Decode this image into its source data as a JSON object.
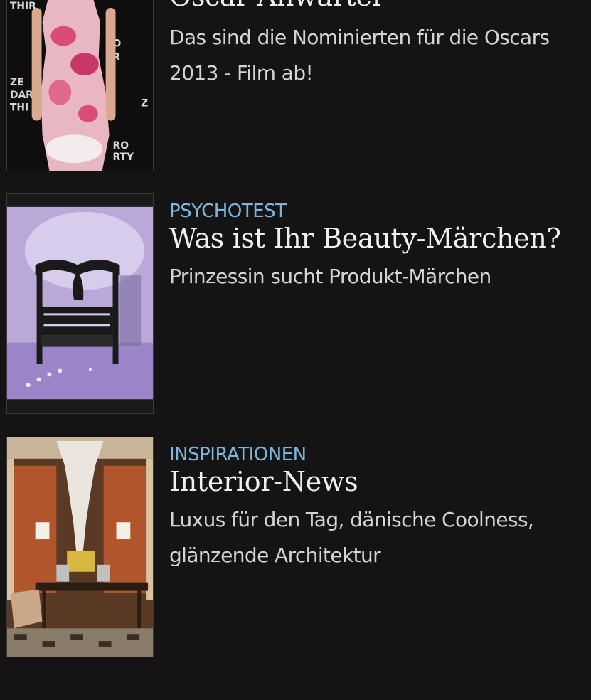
{
  "articles": [
    {
      "kicker": "",
      "headline": "Oscar-Anwärter",
      "teaser_lines": [
        "Das sind die Nominierten für die Oscars",
        "2013 - Film ab!"
      ],
      "thumbnail_icon": "red-carpet-photo"
    },
    {
      "kicker": "PSYCHOTEST",
      "headline": "Was ist Ihr Beauty-Märchen?",
      "teaser_lines": [
        "Prinzessin sucht Produkt-Märchen"
      ],
      "thumbnail_icon": "fairytale-bed-illustration"
    },
    {
      "kicker": "INSPIRATIONEN",
      "headline": "Interior-News",
      "teaser_lines": [
        "Luxus für den Tag, dänische Coolness,",
        "glänzende Architektur"
      ],
      "thumbnail_icon": "interior-chandelier-photo"
    }
  ],
  "colors": {
    "background": "#141414",
    "kicker": "#7fb4dc",
    "headline": "#f0f0f0",
    "teaser": "#d4d4d4"
  }
}
